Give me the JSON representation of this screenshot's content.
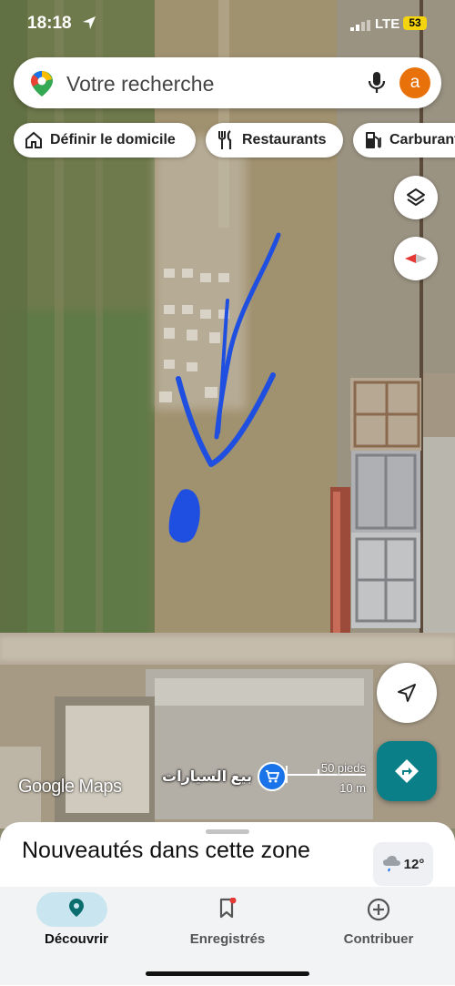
{
  "status_bar": {
    "time": "18:18",
    "network": "LTE",
    "battery": "53"
  },
  "search": {
    "placeholder": "Votre recherche",
    "avatar_letter": "a"
  },
  "chips": [
    {
      "label": "Définir le domicile",
      "icon": "home-icon"
    },
    {
      "label": "Restaurants",
      "icon": "restaurant-icon"
    },
    {
      "label": "Carburant",
      "icon": "fuel-icon"
    }
  ],
  "map": {
    "watermark": "Google Maps",
    "poi_label": "بيع السيارات",
    "poi_icon": "shopping-cart-icon",
    "scale": {
      "imperial": "50 pieds",
      "metric": "10 m"
    },
    "annotation_color": "#1f4fe0"
  },
  "sheet": {
    "title": "Nouveautés dans cette zone",
    "weather": "12°",
    "weather_icon": "cloud-rain-icon"
  },
  "nav": {
    "items": [
      {
        "label": "Découvrir",
        "icon": "location-pin-icon",
        "active": true
      },
      {
        "label": "Enregistrés",
        "icon": "bookmark-icon",
        "active": false
      },
      {
        "label": "Contribuer",
        "icon": "add-circle-icon",
        "active": false
      }
    ]
  },
  "colors": {
    "accent": "#0b7f88",
    "avatar": "#e8710a",
    "active_pill": "#c9e6f0"
  }
}
